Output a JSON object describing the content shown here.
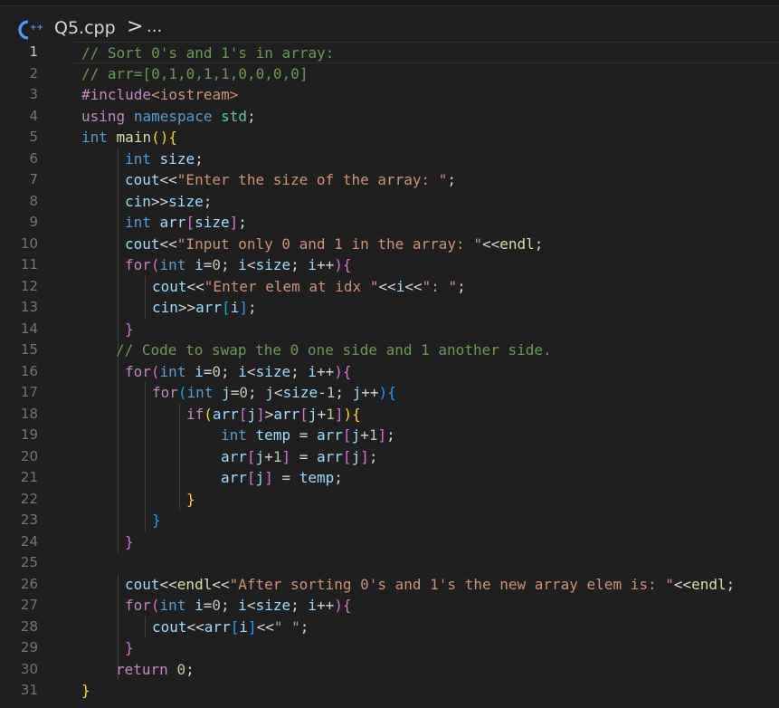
{
  "breadcrumb": {
    "file_icon": "cpp-file-icon",
    "file_name": "Q5.cpp",
    "separator": ">",
    "more": "..."
  },
  "editor": {
    "language": "C++",
    "current_line": 1,
    "colors": {
      "background": "#1f1f1f",
      "comment": "#6a9955",
      "keyword": "#569cd6",
      "control": "#c586c0",
      "string": "#ce9178",
      "number": "#b5cea8",
      "variable": "#9cdcfe",
      "bracket_gold": "#ffd700",
      "bracket_orchid": "#da70d6",
      "bracket_blue": "#179fff"
    },
    "lines": [
      {
        "n": "1",
        "indent": 0,
        "tokens": [
          [
            "cm",
            "// Sort 0's and 1's in array:"
          ]
        ]
      },
      {
        "n": "2",
        "indent": 0,
        "tokens": [
          [
            "cm",
            "// arr=[0,1,0,1,1,0,0,0,0]"
          ]
        ]
      },
      {
        "n": "3",
        "indent": 0,
        "tokens": [
          [
            "ctrl",
            "#include"
          ],
          [
            "str",
            "<iostream>"
          ]
        ]
      },
      {
        "n": "4",
        "indent": 0,
        "tokens": [
          [
            "ctrl",
            "using"
          ],
          [
            "op",
            " "
          ],
          [
            "kw",
            "namespace"
          ],
          [
            "op",
            " "
          ],
          [
            "ns",
            "std"
          ],
          [
            "op",
            ";"
          ]
        ]
      },
      {
        "n": "5",
        "indent": 0,
        "tokens": [
          [
            "kw",
            "int"
          ],
          [
            "op",
            " "
          ],
          [
            "fn",
            "main"
          ],
          [
            "b1",
            "()"
          ],
          [
            "b1",
            "{"
          ]
        ]
      },
      {
        "n": "6",
        "indent": 1,
        "tokens": [
          [
            "kw",
            "int"
          ],
          [
            "op",
            " "
          ],
          [
            "var",
            "size"
          ],
          [
            "op",
            ";"
          ]
        ]
      },
      {
        "n": "7",
        "indent": 1,
        "tokens": [
          [
            "var",
            "cout"
          ],
          [
            "op",
            "<<"
          ],
          [
            "str",
            "\"Enter the size of the array: \""
          ],
          [
            "op",
            ";"
          ]
        ]
      },
      {
        "n": "8",
        "indent": 1,
        "tokens": [
          [
            "var",
            "cin"
          ],
          [
            "op",
            ">>"
          ],
          [
            "var",
            "size"
          ],
          [
            "op",
            ";"
          ]
        ]
      },
      {
        "n": "9",
        "indent": 1,
        "tokens": [
          [
            "kw",
            "int"
          ],
          [
            "op",
            " "
          ],
          [
            "var",
            "arr"
          ],
          [
            "b2",
            "["
          ],
          [
            "var",
            "size"
          ],
          [
            "b2",
            "]"
          ],
          [
            "op",
            ";"
          ]
        ]
      },
      {
        "n": "10",
        "indent": 1,
        "tokens": [
          [
            "var",
            "cout"
          ],
          [
            "op",
            "<<"
          ],
          [
            "str",
            "\"Input only 0 and 1 in the array: \""
          ],
          [
            "op",
            "<<"
          ],
          [
            "fn",
            "endl"
          ],
          [
            "op",
            ";"
          ]
        ]
      },
      {
        "n": "11",
        "indent": 1,
        "tokens": [
          [
            "ctrl",
            "for"
          ],
          [
            "b2",
            "("
          ],
          [
            "kw",
            "int"
          ],
          [
            "op",
            " "
          ],
          [
            "var",
            "i"
          ],
          [
            "op",
            "="
          ],
          [
            "num",
            "0"
          ],
          [
            "op",
            "; "
          ],
          [
            "var",
            "i"
          ],
          [
            "op",
            "<"
          ],
          [
            "var",
            "size"
          ],
          [
            "op",
            "; "
          ],
          [
            "var",
            "i"
          ],
          [
            "op",
            "++"
          ],
          [
            "b2",
            ")"
          ],
          [
            "b2",
            "{"
          ]
        ]
      },
      {
        "n": "12",
        "indent": 2,
        "tokens": [
          [
            "var",
            "cout"
          ],
          [
            "op",
            "<<"
          ],
          [
            "str",
            "\"Enter elem at idx \""
          ],
          [
            "op",
            "<<"
          ],
          [
            "var",
            "i"
          ],
          [
            "op",
            "<<"
          ],
          [
            "str",
            "\": \""
          ],
          [
            "op",
            ";"
          ]
        ]
      },
      {
        "n": "13",
        "indent": 2,
        "tokens": [
          [
            "var",
            "cin"
          ],
          [
            "op",
            ">>"
          ],
          [
            "var",
            "arr"
          ],
          [
            "b3",
            "["
          ],
          [
            "var",
            "i"
          ],
          [
            "b3",
            "]"
          ],
          [
            "op",
            ";"
          ]
        ]
      },
      {
        "n": "14",
        "indent": 1,
        "tokens": [
          [
            "b2",
            "}"
          ]
        ]
      },
      {
        "n": "15",
        "indent": 1,
        "tokens": [
          [
            "cm",
            "// Code to swap the 0 one side and 1 another side."
          ]
        ],
        "offset": -10
      },
      {
        "n": "16",
        "indent": 1,
        "tokens": [
          [
            "ctrl",
            "for"
          ],
          [
            "b2",
            "("
          ],
          [
            "kw",
            "int"
          ],
          [
            "op",
            " "
          ],
          [
            "var",
            "i"
          ],
          [
            "op",
            "="
          ],
          [
            "num",
            "0"
          ],
          [
            "op",
            "; "
          ],
          [
            "var",
            "i"
          ],
          [
            "op",
            "<"
          ],
          [
            "var",
            "size"
          ],
          [
            "op",
            "; "
          ],
          [
            "var",
            "i"
          ],
          [
            "op",
            "++"
          ],
          [
            "b2",
            ")"
          ],
          [
            "b2",
            "{"
          ]
        ]
      },
      {
        "n": "17",
        "indent": 2,
        "tokens": [
          [
            "ctrl",
            "for"
          ],
          [
            "b3",
            "("
          ],
          [
            "kw",
            "int"
          ],
          [
            "op",
            " "
          ],
          [
            "var",
            "j"
          ],
          [
            "op",
            "="
          ],
          [
            "num",
            "0"
          ],
          [
            "op",
            "; "
          ],
          [
            "var",
            "j"
          ],
          [
            "op",
            "<"
          ],
          [
            "var",
            "size"
          ],
          [
            "op",
            "-"
          ],
          [
            "num",
            "1"
          ],
          [
            "op",
            "; "
          ],
          [
            "var",
            "j"
          ],
          [
            "op",
            "++"
          ],
          [
            "b3",
            ")"
          ],
          [
            "b3",
            "{"
          ]
        ]
      },
      {
        "n": "18",
        "indent": 3,
        "tokens": [
          [
            "ctrl",
            "if"
          ],
          [
            "b1",
            "("
          ],
          [
            "var",
            "arr"
          ],
          [
            "b2",
            "["
          ],
          [
            "var",
            "j"
          ],
          [
            "b2",
            "]"
          ],
          [
            "op",
            ">"
          ],
          [
            "var",
            "arr"
          ],
          [
            "b2",
            "["
          ],
          [
            "var",
            "j"
          ],
          [
            "op",
            "+"
          ],
          [
            "num",
            "1"
          ],
          [
            "b2",
            "]"
          ],
          [
            "b1",
            ")"
          ],
          [
            "b1",
            "{"
          ]
        ]
      },
      {
        "n": "19",
        "indent": 4,
        "tokens": [
          [
            "kw",
            "int"
          ],
          [
            "op",
            " "
          ],
          [
            "var",
            "temp"
          ],
          [
            "op",
            " = "
          ],
          [
            "var",
            "arr"
          ],
          [
            "b2",
            "["
          ],
          [
            "var",
            "j"
          ],
          [
            "op",
            "+"
          ],
          [
            "num",
            "1"
          ],
          [
            "b2",
            "]"
          ],
          [
            "op",
            ";"
          ]
        ]
      },
      {
        "n": "20",
        "indent": 4,
        "tokens": [
          [
            "var",
            "arr"
          ],
          [
            "b2",
            "["
          ],
          [
            "var",
            "j"
          ],
          [
            "op",
            "+"
          ],
          [
            "num",
            "1"
          ],
          [
            "b2",
            "]"
          ],
          [
            "op",
            " = "
          ],
          [
            "var",
            "arr"
          ],
          [
            "b2",
            "["
          ],
          [
            "var",
            "j"
          ],
          [
            "b2",
            "]"
          ],
          [
            "op",
            ";"
          ]
        ]
      },
      {
        "n": "21",
        "indent": 4,
        "tokens": [
          [
            "var",
            "arr"
          ],
          [
            "b2",
            "["
          ],
          [
            "var",
            "j"
          ],
          [
            "b2",
            "]"
          ],
          [
            "op",
            " = "
          ],
          [
            "var",
            "temp"
          ],
          [
            "op",
            ";"
          ]
        ]
      },
      {
        "n": "22",
        "indent": 3,
        "tokens": [
          [
            "b1",
            "}"
          ]
        ]
      },
      {
        "n": "23",
        "indent": 2,
        "tokens": [
          [
            "b3",
            "}"
          ]
        ]
      },
      {
        "n": "24",
        "indent": 1,
        "tokens": [
          [
            "b2",
            "}"
          ]
        ]
      },
      {
        "n": "25",
        "indent": 0,
        "tokens": []
      },
      {
        "n": "26",
        "indent": 1,
        "tokens": [
          [
            "var",
            "cout"
          ],
          [
            "op",
            "<<"
          ],
          [
            "fn",
            "endl"
          ],
          [
            "op",
            "<<"
          ],
          [
            "str",
            "\"After sorting 0's and 1's the new array elem is: \""
          ],
          [
            "op",
            "<<"
          ],
          [
            "fn",
            "endl"
          ],
          [
            "op",
            ";"
          ]
        ]
      },
      {
        "n": "27",
        "indent": 1,
        "tokens": [
          [
            "ctrl",
            "for"
          ],
          [
            "b2",
            "("
          ],
          [
            "kw",
            "int"
          ],
          [
            "op",
            " "
          ],
          [
            "var",
            "i"
          ],
          [
            "op",
            "="
          ],
          [
            "num",
            "0"
          ],
          [
            "op",
            "; "
          ],
          [
            "var",
            "i"
          ],
          [
            "op",
            "<"
          ],
          [
            "var",
            "size"
          ],
          [
            "op",
            "; "
          ],
          [
            "var",
            "i"
          ],
          [
            "op",
            "++"
          ],
          [
            "b2",
            ")"
          ],
          [
            "b2",
            "{"
          ]
        ]
      },
      {
        "n": "28",
        "indent": 2,
        "tokens": [
          [
            "var",
            "cout"
          ],
          [
            "op",
            "<<"
          ],
          [
            "var",
            "arr"
          ],
          [
            "b3",
            "["
          ],
          [
            "var",
            "i"
          ],
          [
            "b3",
            "]"
          ],
          [
            "op",
            "<<"
          ],
          [
            "str",
            "\" \""
          ],
          [
            "op",
            ";"
          ]
        ]
      },
      {
        "n": "29",
        "indent": 1,
        "tokens": [
          [
            "b2",
            "}"
          ]
        ]
      },
      {
        "n": "30",
        "indent": 1,
        "tokens": [
          [
            "ctrl",
            "return"
          ],
          [
            "op",
            " "
          ],
          [
            "num",
            "0"
          ],
          [
            "op",
            ";"
          ]
        ],
        "offset": -10
      },
      {
        "n": "31",
        "indent": 0,
        "tokens": [
          [
            "b1",
            "}"
          ]
        ]
      }
    ]
  }
}
